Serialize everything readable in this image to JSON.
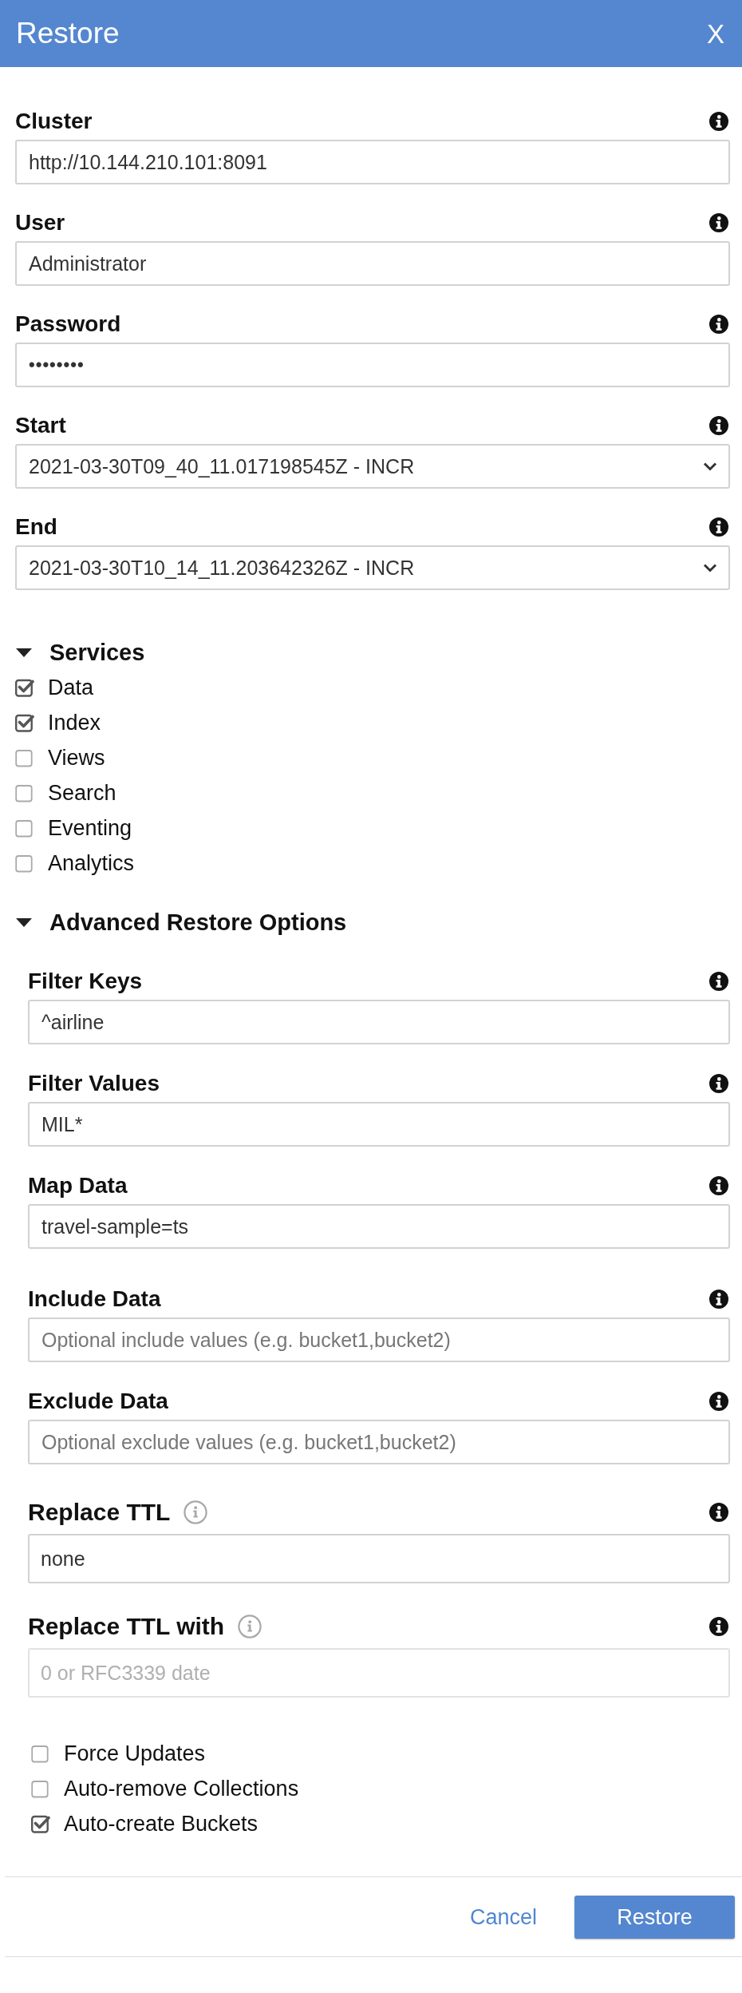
{
  "dialog": {
    "title": "Restore",
    "close": "X"
  },
  "fields": [
    {
      "label": "Cluster",
      "kind": "text",
      "value": "http://10.144.210.101:8091"
    },
    {
      "label": "User",
      "kind": "text",
      "value": "Administrator"
    },
    {
      "label": "Password",
      "kind": "password",
      "value": "••••••••"
    },
    {
      "label": "Start",
      "kind": "select",
      "value": "2021-03-30T09_40_11.017198545Z - INCR"
    },
    {
      "label": "End",
      "kind": "select",
      "value": "2021-03-30T10_14_11.203642326Z - INCR"
    }
  ],
  "services": {
    "title": "Services",
    "expanded": true,
    "items": [
      {
        "label": "Data",
        "checked": true
      },
      {
        "label": "Index",
        "checked": true
      },
      {
        "label": "Views",
        "checked": false
      },
      {
        "label": "Search",
        "checked": false
      },
      {
        "label": "Eventing",
        "checked": false
      },
      {
        "label": "Analytics",
        "checked": false
      }
    ]
  },
  "advanced": {
    "title": "Advanced Restore Options",
    "expanded": true,
    "fields": [
      {
        "label": "Filter Keys",
        "value": "^airline",
        "inline_info": false,
        "disabled": false
      },
      {
        "label": "Filter Values",
        "value": "MIL*",
        "inline_info": false,
        "disabled": false
      },
      {
        "label": "Map Data",
        "value": "travel-sample=ts",
        "inline_info": false,
        "disabled": false
      },
      {
        "label": "Include Data",
        "placeholder": "Optional include values (e.g. bucket1,bucket2)",
        "inline_info": false,
        "disabled": false
      },
      {
        "label": "Exclude Data",
        "placeholder": "Optional exclude values (e.g. bucket1,bucket2)",
        "inline_info": false,
        "disabled": false
      },
      {
        "label": "Replace TTL",
        "value": "none",
        "inline_info": true,
        "disabled": false
      },
      {
        "label": "Replace TTL with",
        "placeholder": "0 or RFC3339 date",
        "inline_info": true,
        "disabled": true
      }
    ],
    "options": [
      {
        "label": "Force Updates",
        "checked": false
      },
      {
        "label": "Auto-remove Collections",
        "checked": false
      },
      {
        "label": "Auto-create Buckets",
        "checked": true
      }
    ]
  },
  "footer": {
    "cancel": "Cancel",
    "submit": "Restore"
  }
}
